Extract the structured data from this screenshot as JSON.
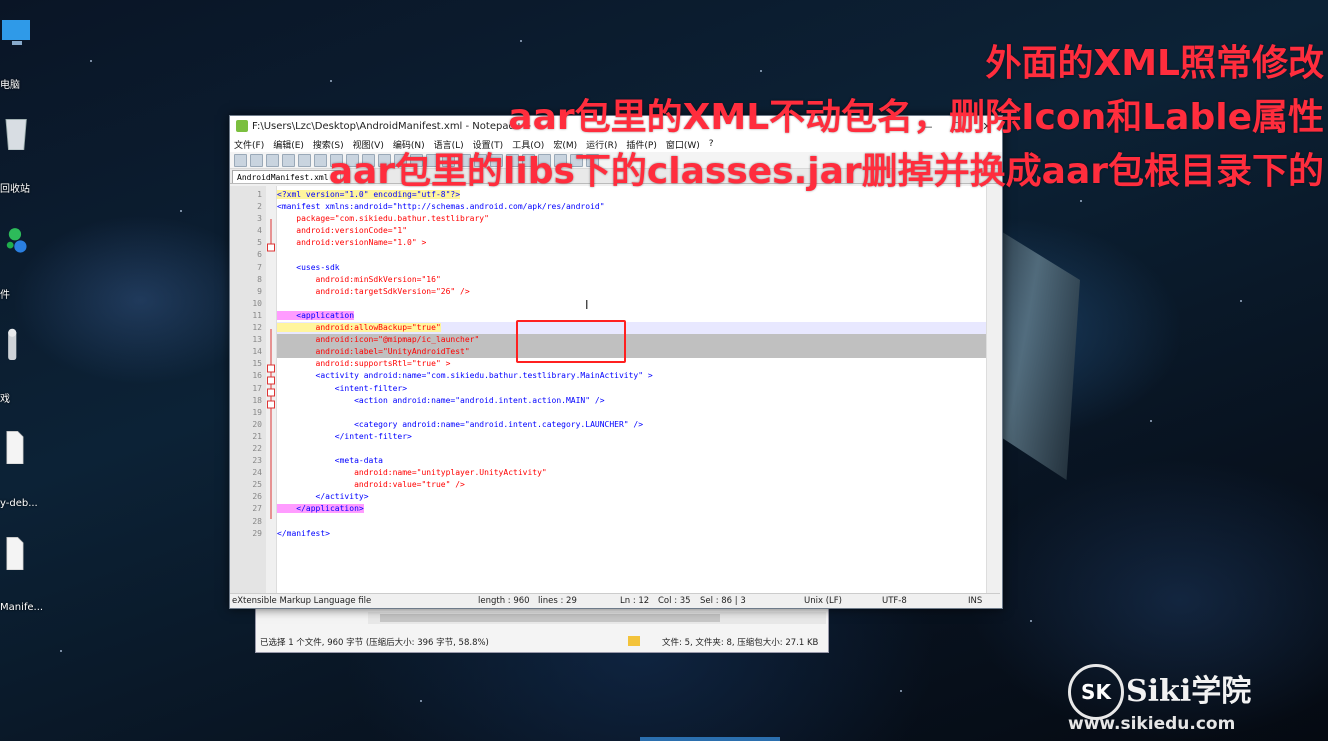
{
  "desktop": {
    "icons": [
      {
        "label": "电脑",
        "icon": "computer-icon"
      },
      {
        "label": "回收站",
        "icon": "recycle-bin-icon"
      },
      {
        "label": "件",
        "icon": "app-icon"
      },
      {
        "label": "戏",
        "icon": "game-icon"
      },
      {
        "label": "y-deb...",
        "icon": "file-icon"
      },
      {
        "label": "Manife...",
        "icon": "file-icon"
      }
    ]
  },
  "captions": [
    "外面的XML照常修改",
    "aar包里的XML不动包名，删除Icon和Lable属性",
    "aar包里的libs下的classes.jar删掉并换成aar包根目录下的"
  ],
  "window": {
    "title": "F:\\Users\\Lzc\\Desktop\\AndroidManifest.xml - Notepad++",
    "menu": [
      "文件(F)",
      "编辑(E)",
      "搜索(S)",
      "视图(V)",
      "编码(N)",
      "语言(L)",
      "设置(T)",
      "工具(O)",
      "宏(M)",
      "运行(R)",
      "插件(P)",
      "窗口(W)",
      "?"
    ],
    "tab": "AndroidManifest.xml"
  },
  "editor": {
    "line_numbers": [
      "1",
      "2",
      "3",
      "4",
      "5",
      "6",
      "7",
      "8",
      "9",
      "10",
      "11",
      "12",
      "13",
      "14",
      "15",
      "16",
      "17",
      "18",
      "19",
      "20",
      "21",
      "22",
      "23",
      "24",
      "25",
      "26",
      "27",
      "28",
      "29"
    ],
    "lines": [
      "<?xml version=\"1.0\" encoding=\"utf-8\"?>",
      "<manifest xmlns:android=\"http://schemas.android.com/apk/res/android\"",
      "    package=\"com.sikiedu.bathur.testlibrary\"",
      "    android:versionCode=\"1\"",
      "    android:versionName=\"1.0\" >",
      "",
      "    <uses-sdk",
      "        android:minSdkVersion=\"16\"",
      "        android:targetSdkVersion=\"26\" />",
      "",
      "    <application",
      "        android:allowBackup=\"true\"",
      "        android:icon=\"@mipmap/ic_launcher\"",
      "        android:label=\"UnityAndroidTest\"",
      "        android:supportsRtl=\"true\" >",
      "        <activity android:name=\"com.sikiedu.bathur.testlibrary.MainActivity\" >",
      "            <intent-filter>",
      "                <action android:name=\"android.intent.action.MAIN\" />",
      "",
      "                <category android:name=\"android.intent.category.LAUNCHER\" />",
      "            </intent-filter>",
      "",
      "            <meta-data",
      "                android:name=\"unityplayer.UnityActivity\"",
      "                android:value=\"true\" />",
      "        </activity>",
      "    </application>",
      "",
      "</manifest>"
    ]
  },
  "status": {
    "filetype": "eXtensible Markup Language file",
    "length": "length : 960",
    "lines": "lines : 29",
    "ln": "Ln : 12",
    "col": "Col : 35",
    "sel": "Sel : 86 | 3",
    "eol": "Unix (LF)",
    "encoding": "UTF-8",
    "mode": "INS"
  },
  "explorer": {
    "selected": "已选择 1 个文件, 960 字节 (压缩后大小: 396 字节, 58.8%)",
    "summary": "文件: 5, 文件夹: 8, 压缩包大小: 27.1 KB"
  },
  "logo": {
    "mark": "SK",
    "brand": "Siki学院",
    "url": "www.sikiedu.com"
  }
}
